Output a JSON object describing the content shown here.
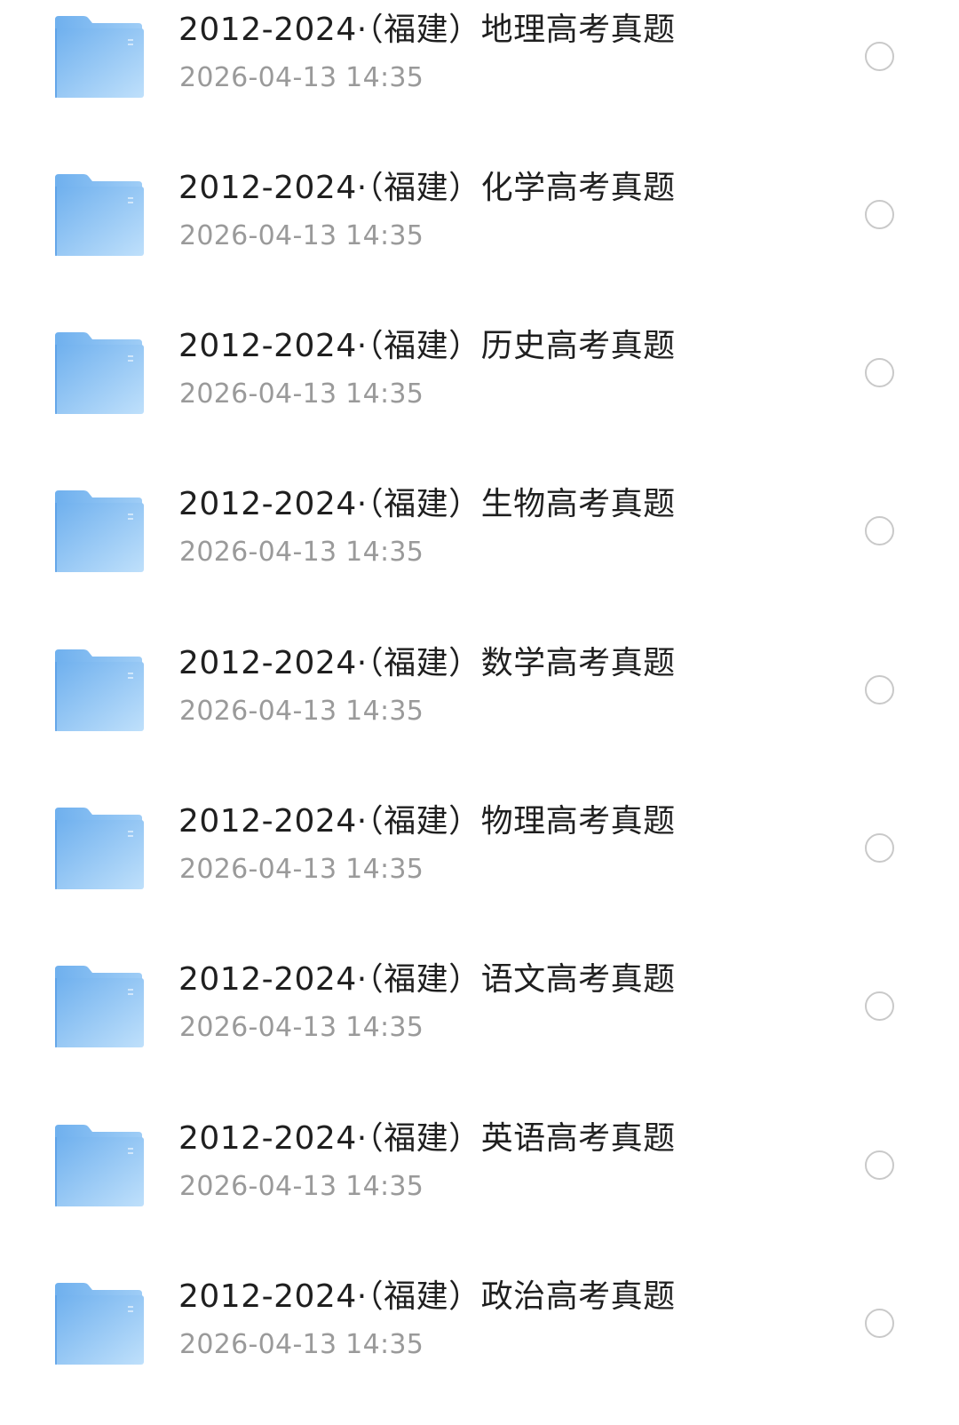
{
  "colors": {
    "title_text": "#1f1f1f",
    "meta_text": "#9a9a9a",
    "folder_light": "#bfe0fb",
    "folder_dark": "#6fb0ee",
    "radio_border": "#c9c9c9"
  },
  "icons": {
    "folder": "folder-icon",
    "select": "radio-unselected-icon"
  },
  "files": [
    {
      "name": "2012-2024·（福建）地理高考真题",
      "modified": "2026-04-13 14:35",
      "selected": false
    },
    {
      "name": "2012-2024·（福建）化学高考真题",
      "modified": "2026-04-13 14:35",
      "selected": false
    },
    {
      "name": "2012-2024·（福建）历史高考真题",
      "modified": "2026-04-13 14:35",
      "selected": false
    },
    {
      "name": "2012-2024·（福建）生物高考真题",
      "modified": "2026-04-13 14:35",
      "selected": false
    },
    {
      "name": "2012-2024·（福建）数学高考真题",
      "modified": "2026-04-13 14:35",
      "selected": false
    },
    {
      "name": "2012-2024·（福建）物理高考真题",
      "modified": "2026-04-13 14:35",
      "selected": false
    },
    {
      "name": "2012-2024·（福建）语文高考真题",
      "modified": "2026-04-13 14:35",
      "selected": false
    },
    {
      "name": "2012-2024·（福建）英语高考真题",
      "modified": "2026-04-13 14:35",
      "selected": false
    },
    {
      "name": "2012-2024·（福建）政治高考真题",
      "modified": "2026-04-13 14:35",
      "selected": false
    }
  ]
}
